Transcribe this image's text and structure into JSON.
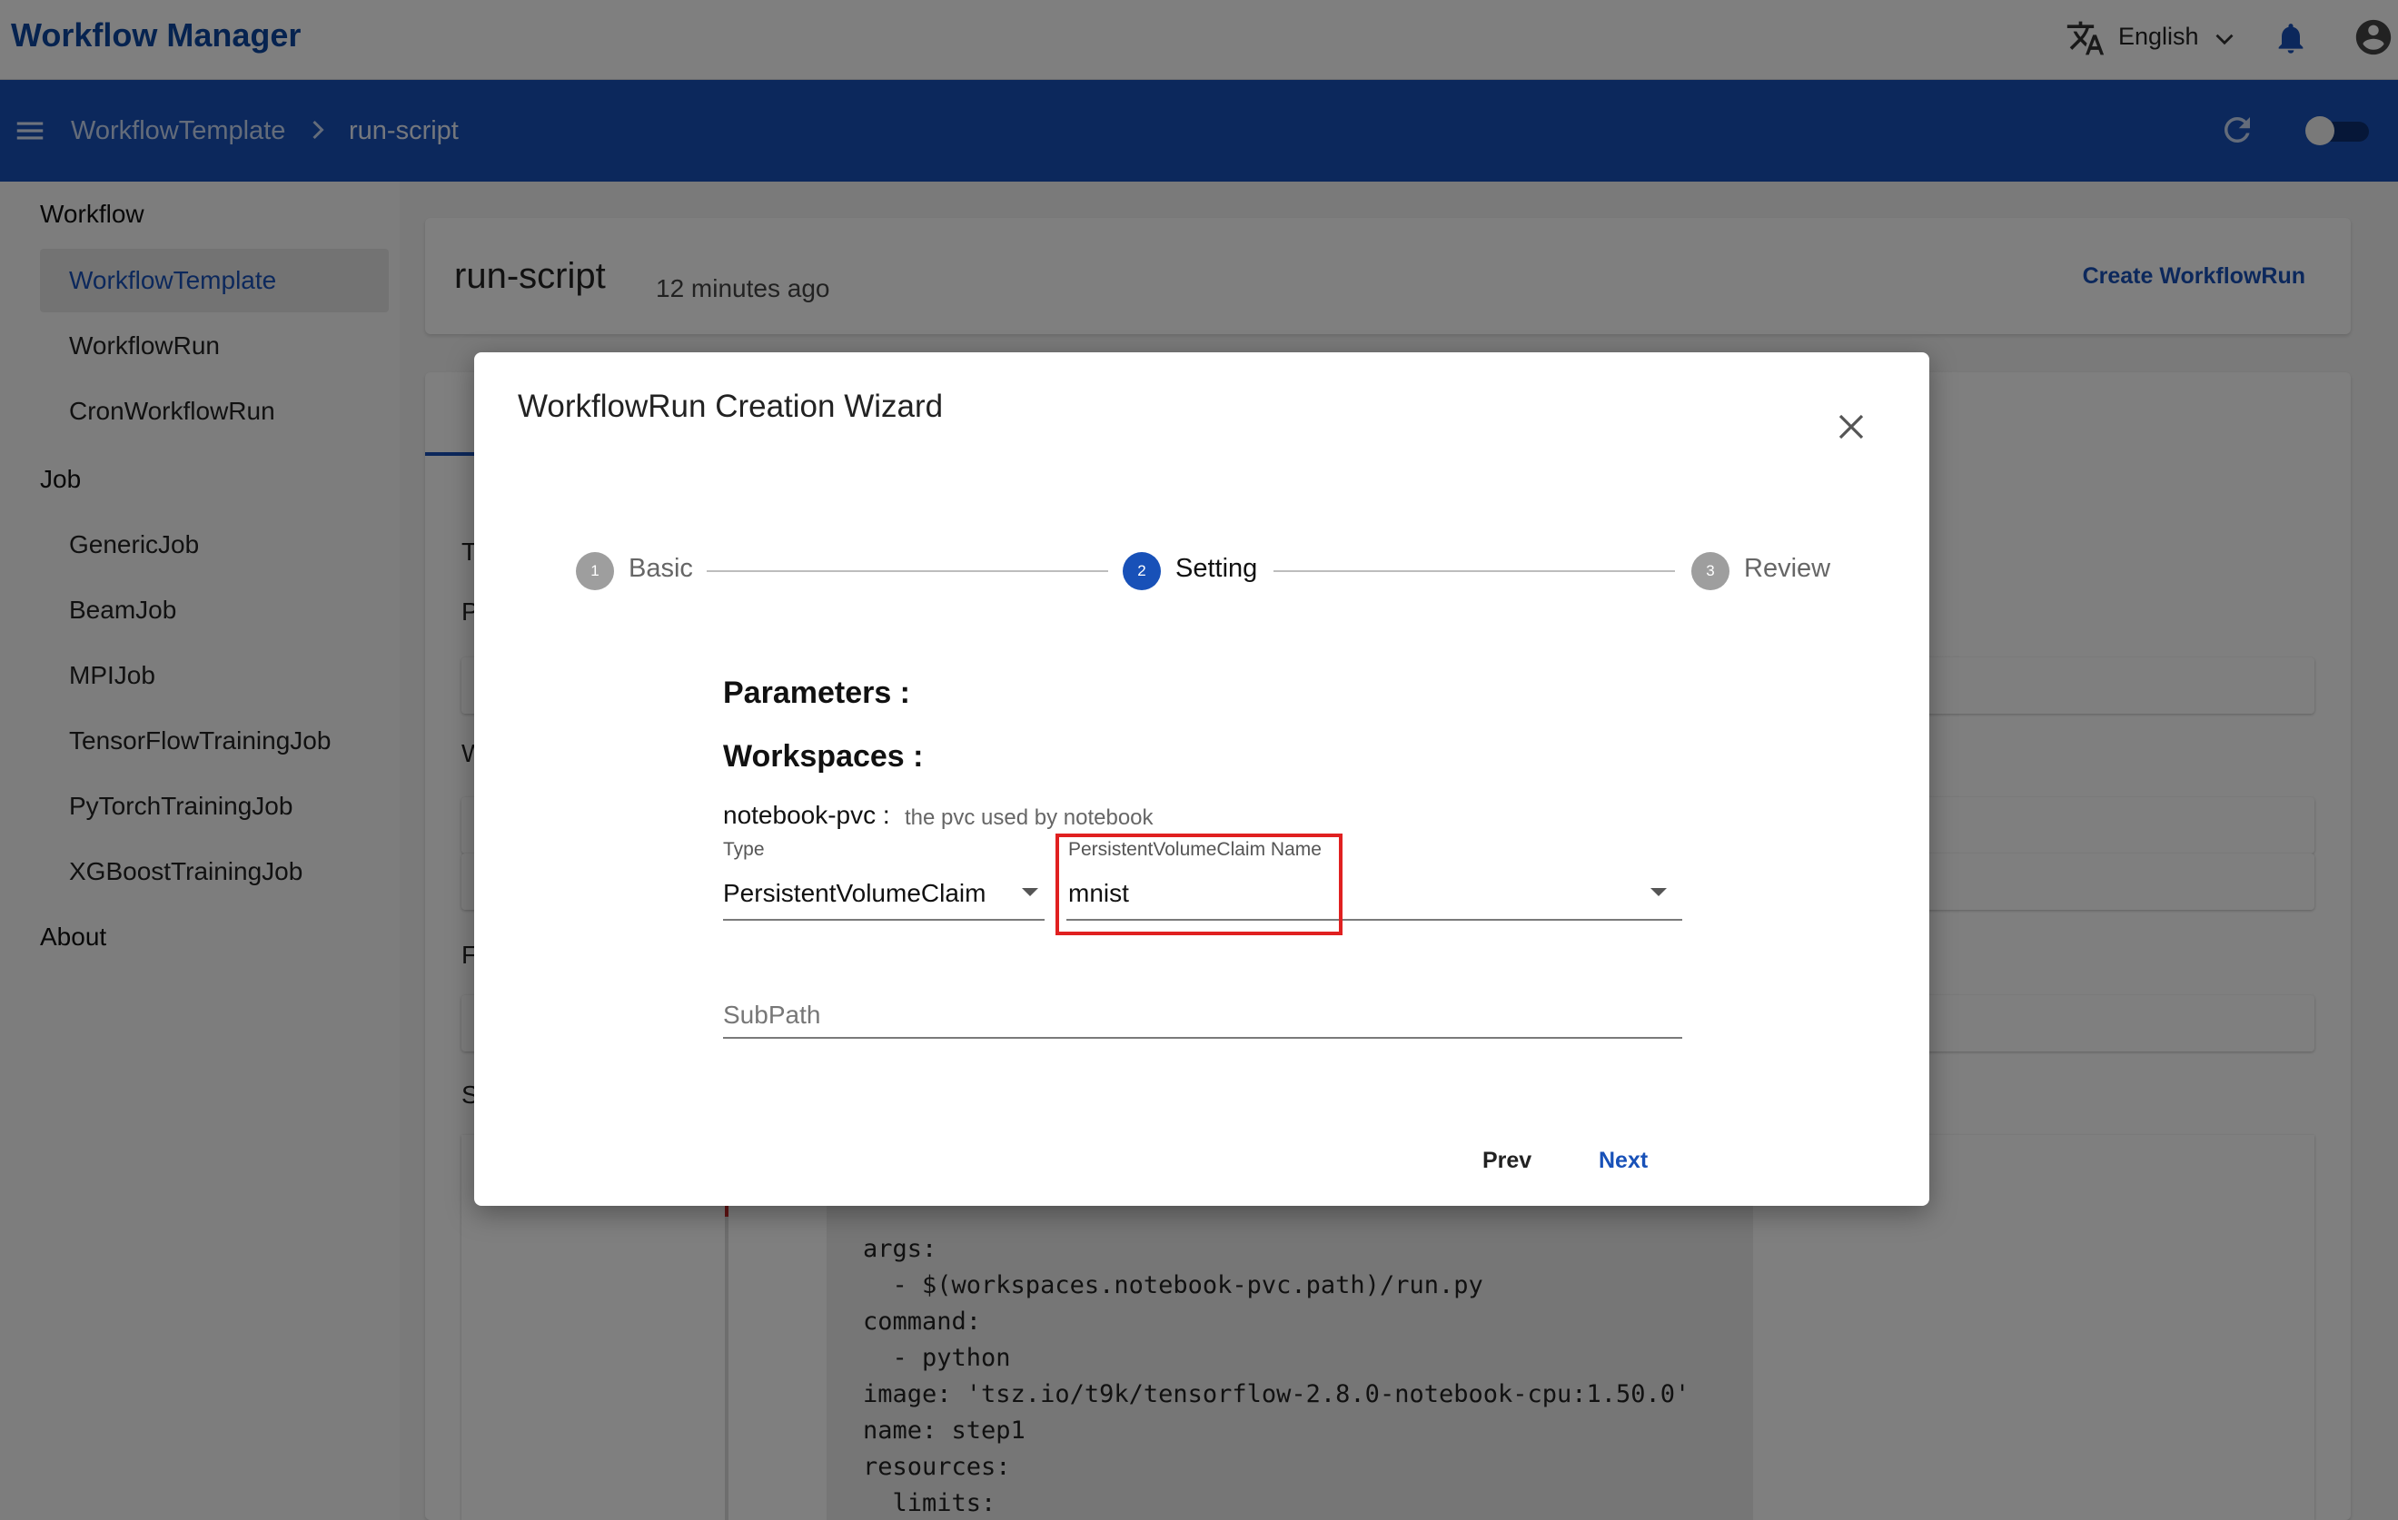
{
  "header": {
    "app_title": "Workflow Manager",
    "language": "English",
    "icons": [
      "translate-icon",
      "chevron-down-icon",
      "bell-icon",
      "account-icon"
    ]
  },
  "navbar": {
    "breadcrumb": [
      "WorkflowTemplate",
      "run-script"
    ],
    "icons": [
      "menu-icon",
      "chevron-right-icon",
      "refresh-icon",
      "toggle-switch"
    ]
  },
  "sidebar": {
    "groups": [
      {
        "label": "Workflow",
        "items": [
          "WorkflowTemplate",
          "WorkflowRun",
          "CronWorkflowRun"
        ]
      },
      {
        "label": "Job",
        "items": [
          "GenericJob",
          "BeamJob",
          "MPIJob",
          "TensorFlowTrainingJob",
          "PyTorchTrainingJob",
          "XGBoostTrainingJob"
        ]
      },
      {
        "label": "About",
        "items": []
      }
    ],
    "active_item": "WorkflowTemplate"
  },
  "page": {
    "title": "run-script",
    "time": "12 minutes ago",
    "action": "Create WorkflowRun",
    "partial_letters": [
      "T",
      "P",
      "W",
      "F",
      "S"
    ],
    "code_lines": [
      "args:",
      "  - $(workspaces.notebook-pvc.path)/run.py",
      "command:",
      "  - python",
      "image: 'tsz.io/t9k/tensorflow-2.8.0-notebook-cpu:1.50.0'",
      "name: step1",
      "resources:",
      "  limits:"
    ]
  },
  "dialog": {
    "title": "WorkflowRun Creation Wizard",
    "steps": [
      {
        "number": "1",
        "label": "Basic",
        "active": false
      },
      {
        "number": "2",
        "label": "Setting",
        "active": true
      },
      {
        "number": "3",
        "label": "Review",
        "active": false
      }
    ],
    "parameters_heading": "Parameters :",
    "workspaces_heading": "Workspaces :",
    "workspace": {
      "name": "notebook-pvc :",
      "description": "the pvc used by notebook",
      "type_label": "Type",
      "type_value": "PersistentVolumeClaim",
      "pvc_label": "PersistentVolumeClaim Name",
      "pvc_value": "mnist",
      "subpath_placeholder": "SubPath"
    },
    "prev_label": "Prev",
    "next_label": "Next",
    "accent_color": "#1851b8",
    "highlight_color": "#e02020"
  }
}
